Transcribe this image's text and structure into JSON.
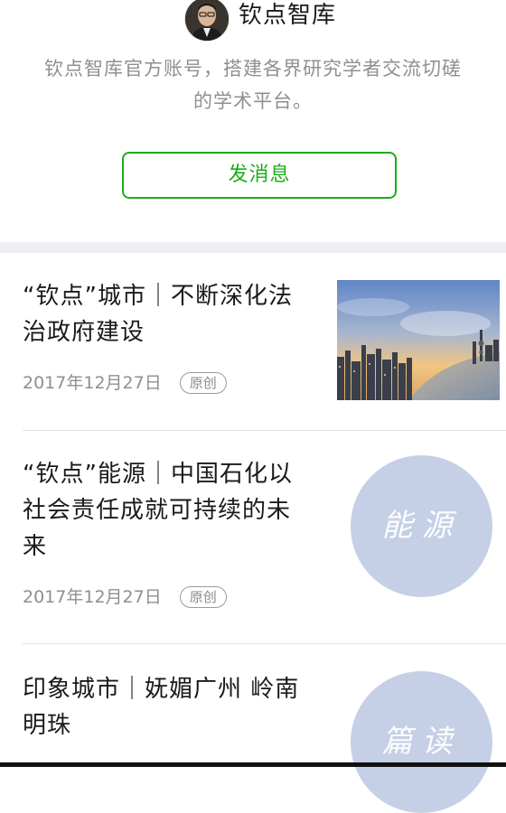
{
  "profile": {
    "account_name": "钦点智库",
    "description_line1": "钦点智库官方账号，搭建各界研究学者交流切磋",
    "description_line2": "的学术平台。",
    "send_message_label": "发消息"
  },
  "articles": [
    {
      "title_line1": "“钦点”城市｜不断深化法",
      "title_line2": "治政府建设",
      "date": "2017年12月27日",
      "badge": "原创",
      "thumb_type": "photo"
    },
    {
      "title_line1": "“钦点”能源｜中国石化以",
      "title_line2": "社会责任成就可持续的未",
      "title_line3": "来",
      "date": "2017年12月27日",
      "badge": "原创",
      "thumb_type": "circle",
      "thumb_text": "能源",
      "thumb_color": "#c5cfe6"
    },
    {
      "title_line1": "印象城市｜妩媚广州 岭南",
      "title_line2": "明珠",
      "thumb_type": "circle",
      "thumb_text": "篇读",
      "thumb_color": "#c5cfe6"
    }
  ],
  "colors": {
    "accent_green": "#1aad19",
    "muted_text": "#8f8f8f",
    "separator_band": "#efeff4"
  }
}
